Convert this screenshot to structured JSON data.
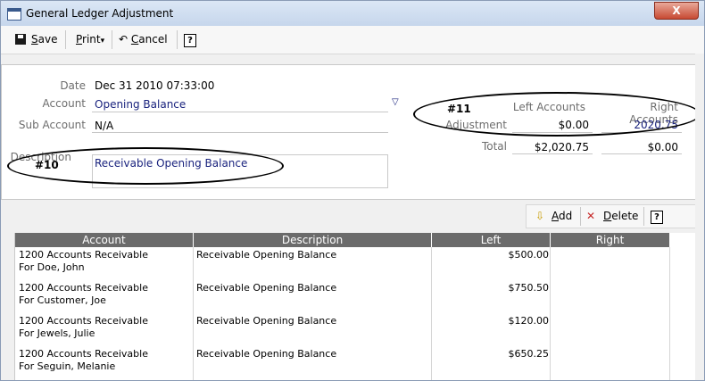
{
  "window": {
    "title": "General Ledger Adjustment",
    "close_label": "X"
  },
  "toolbar": {
    "save": {
      "prefix": "S",
      "rest": "ave"
    },
    "print": {
      "prefix": "P",
      "rest": "rint"
    },
    "cancel": {
      "prefix": "C",
      "rest": "ancel"
    },
    "help": "?",
    "undo_glyph": "↶",
    "dropdown_glyph": "▾"
  },
  "form": {
    "date_label": "Date",
    "date_value": "Dec 31 2010 07:33:00",
    "account_label": "Account",
    "account_value": "Opening Balance",
    "account_dropdown_glyph": "▽",
    "sub_account_label": "Sub Account",
    "sub_account_value": "N/A",
    "description_label": "Description",
    "description_value": "Receivable Opening Balance"
  },
  "annotations": {
    "mark10": "#10",
    "mark11": "#11"
  },
  "totals": {
    "left_header": "Left Accounts",
    "right_header": "Right Accounts",
    "adjustment_label": "Adjustment",
    "adjustment_left": "$0.00",
    "adjustment_right": "2020.75",
    "total_label": "Total",
    "total_left": "$2,020.75",
    "total_right": "$0.00"
  },
  "actions": {
    "add": {
      "prefix": "A",
      "rest": "dd"
    },
    "delete": {
      "prefix": "D",
      "rest": "elete"
    },
    "help": "?",
    "add_glyph": "⇩",
    "delete_glyph": "✕"
  },
  "grid": {
    "columns": [
      "Account",
      "Description",
      "Left",
      "Right"
    ],
    "rows": [
      {
        "account": "1200 Accounts Receivable",
        "for": "For Doe, John",
        "description": "Receivable Opening Balance",
        "left": "$500.00",
        "right": ""
      },
      {
        "account": "1200 Accounts Receivable",
        "for": "For Customer, Joe",
        "description": "Receivable Opening Balance",
        "left": "$750.50",
        "right": ""
      },
      {
        "account": "1200 Accounts Receivable",
        "for": "For Jewels, Julie",
        "description": "Receivable Opening Balance",
        "left": "$120.00",
        "right": ""
      },
      {
        "account": "1200 Accounts Receivable",
        "for": "For Seguin, Melanie",
        "description": "Receivable Opening Balance",
        "left": "$650.25",
        "right": ""
      }
    ]
  }
}
